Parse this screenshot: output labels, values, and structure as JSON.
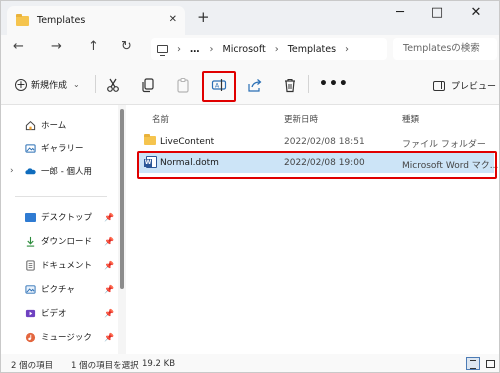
{
  "window": {
    "tab_title": "Templates",
    "new_tab": "+",
    "controls": {
      "minimize": "─",
      "maximize": "□",
      "close": "✕"
    }
  },
  "nav": {
    "back": "←",
    "forward": "→",
    "up": "↑",
    "refresh": "↻",
    "path": [
      "Microsoft",
      "Templates"
    ],
    "more_path": "…",
    "search_placeholder": "Templatesの検索"
  },
  "toolbar": {
    "new_label": "新規作成",
    "more": "•••",
    "preview_label": "プレビュー",
    "icons": [
      "cut-icon",
      "copy-icon",
      "paste-icon",
      "rename-icon",
      "share-icon",
      "delete-icon"
    ],
    "highlighted": "rename-icon"
  },
  "sidebar": {
    "top_items": [
      {
        "label": "ホーム",
        "icon": "home-icon"
      },
      {
        "label": "ギャラリー",
        "icon": "gallery-icon"
      },
      {
        "label": "一郎 - 個人用",
        "icon": "onedrive-icon"
      }
    ],
    "pinned_items": [
      {
        "label": "デスクトップ",
        "icon": "desktop-icon"
      },
      {
        "label": "ダウンロード",
        "icon": "download-icon"
      },
      {
        "label": "ドキュメント",
        "icon": "documents-icon"
      },
      {
        "label": "ピクチャ",
        "icon": "pictures-icon"
      },
      {
        "label": "ビデオ",
        "icon": "videos-icon"
      },
      {
        "label": "ミュージック",
        "icon": "music-icon"
      }
    ]
  },
  "files": {
    "columns": [
      "名前",
      "更新日時",
      "種類"
    ],
    "rows": [
      {
        "name": "LiveContent",
        "date": "2022/02/08 18:51",
        "type": "ファイル フォルダー",
        "icon": "folder-icon",
        "selected": false
      },
      {
        "name": "Normal.dotm",
        "date": "2022/02/08 19:00",
        "type": "Microsoft Word マク...",
        "icon": "word-template-icon",
        "selected": true
      }
    ]
  },
  "status": {
    "count": "2 個の項目",
    "selection": "1 個の項目を選択",
    "size": "19.2 KB"
  },
  "colors": {
    "selection": "#cce4f7",
    "highlight_box": "#e00000",
    "folder": "#f5c44e"
  }
}
